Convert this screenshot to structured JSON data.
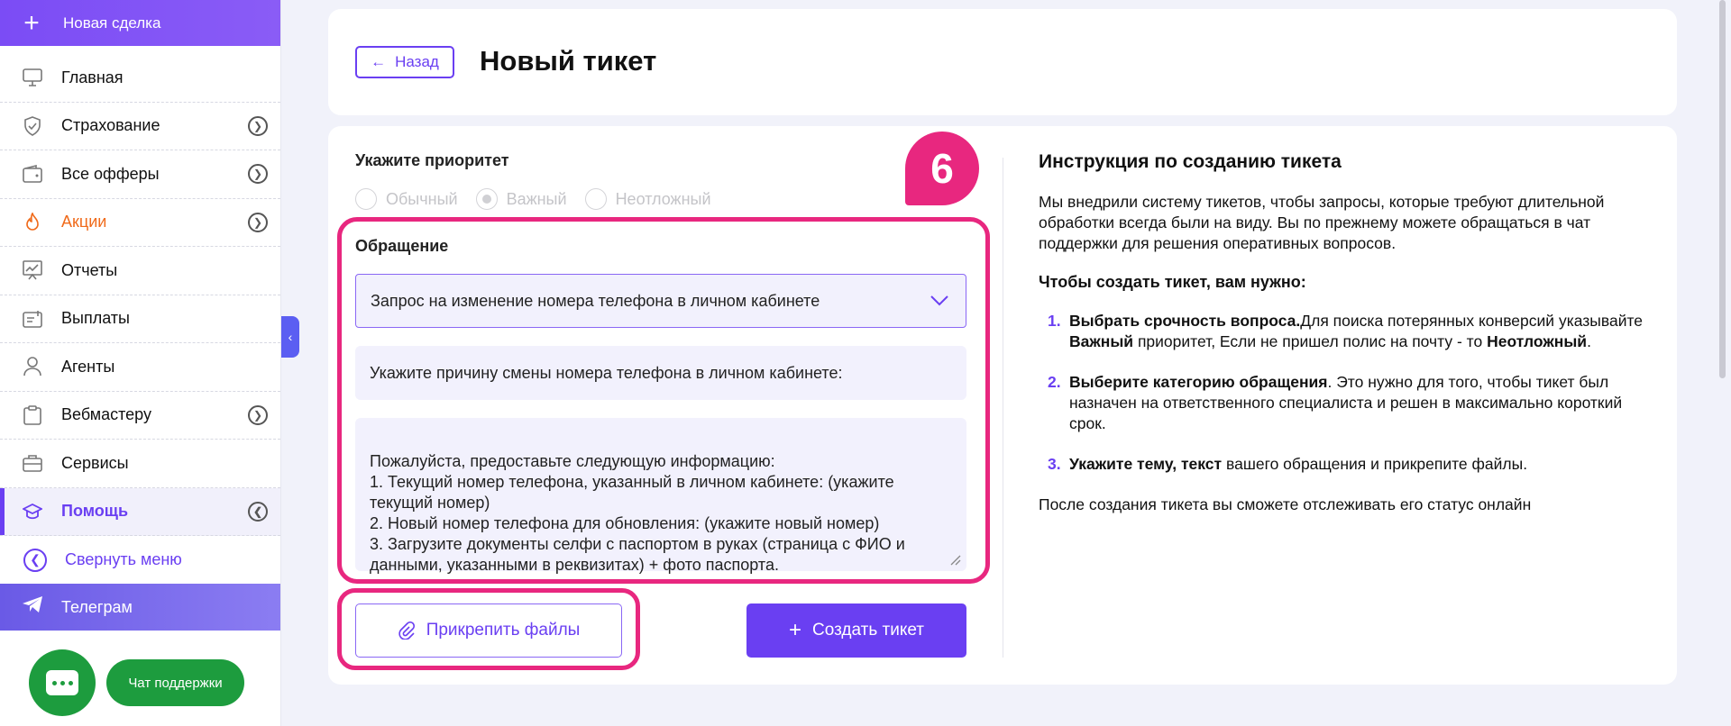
{
  "sidebar": {
    "new_deal": "Новая сделка",
    "items": [
      {
        "label": "Главная",
        "icon": "monitor-icon"
      },
      {
        "label": "Страхование",
        "icon": "shield-icon"
      },
      {
        "label": "Все офферы",
        "icon": "wallet-icon"
      },
      {
        "label": "Акции",
        "icon": "fire-icon"
      },
      {
        "label": "Отчеты",
        "icon": "chart-board-icon"
      },
      {
        "label": "Выплаты",
        "icon": "payout-icon"
      },
      {
        "label": "Агенты",
        "icon": "user-icon"
      },
      {
        "label": "Вебмастеру",
        "icon": "clipboard-icon"
      },
      {
        "label": "Сервисы",
        "icon": "briefcase-icon"
      },
      {
        "label": "Помощь",
        "icon": "graduation-icon"
      }
    ],
    "collapse": "Свернуть меню",
    "telegram": "Телеграм",
    "chat_support": "Чат поддержки"
  },
  "header": {
    "back": "Назад",
    "title": "Новый тикет"
  },
  "form": {
    "priority_label": "Укажите приоритет",
    "priorities": [
      "Обычный",
      "Важный",
      "Неотложный"
    ],
    "selected_priority": "Важный",
    "request_label": "Обращение",
    "request_value": "Запрос на изменение номера телефона в личном кабинете",
    "reason_text": "Укажите причину смены номера телефона в личном кабинете:",
    "details_text": "Пожалуйста, предоставьте следующую информацию:\n1. Текущий номер телефона, указанный в личном кабинете: (укажите текущий номер)\n2. Новый номер телефона для обновления: (укажите новый номер)\n3. Загрузите документы селфи с паспортом в руках (страница с ФИО и данными, указанными в реквизитах) + фото паспорта.",
    "attach_button": "Прикрепить файлы",
    "create_button": "Создать тикет"
  },
  "step_badge": "6",
  "instructions": {
    "title": "Инструкция по созданию тикета",
    "intro": "Мы внедрили систему тикетов, чтобы запросы, которые требуют длительной обработки всегда были на виду. Вы по прежнему можете обращаться в чат поддержки для решения оперативных вопросов.",
    "subhead": "Чтобы создать тикет, вам нужно:",
    "step1_num": "1.",
    "step1_bold": "Выбрать срочность вопроса.",
    "step1_text": "Для поиска потерянных конверсий указывайте",
    "step1_bold2": "Важный",
    "step1_text2": "приоритет, Если не пришел полис на почту - то",
    "step1_bold3": "Неотложный",
    "step1_end": ".",
    "step2_num": "2.",
    "step2_bold": "Выберите категорию обращения",
    "step2_text": ". Это нужно для того, чтобы тикет был назначен на ответственного специалиста и решен в максимально короткий срок.",
    "step3_num": "3.",
    "step3_bold": "Укажите тему, текст",
    "step3_text": "вашего обращения и прикрепите файлы.",
    "footer": "После создания тикета вы сможете отслеживать его статус онлайн"
  },
  "colors": {
    "accent": "#6a3ff2",
    "highlight": "#e8277f",
    "chat_green": "#1d9c3e",
    "promo_orange": "#f06a1a"
  }
}
